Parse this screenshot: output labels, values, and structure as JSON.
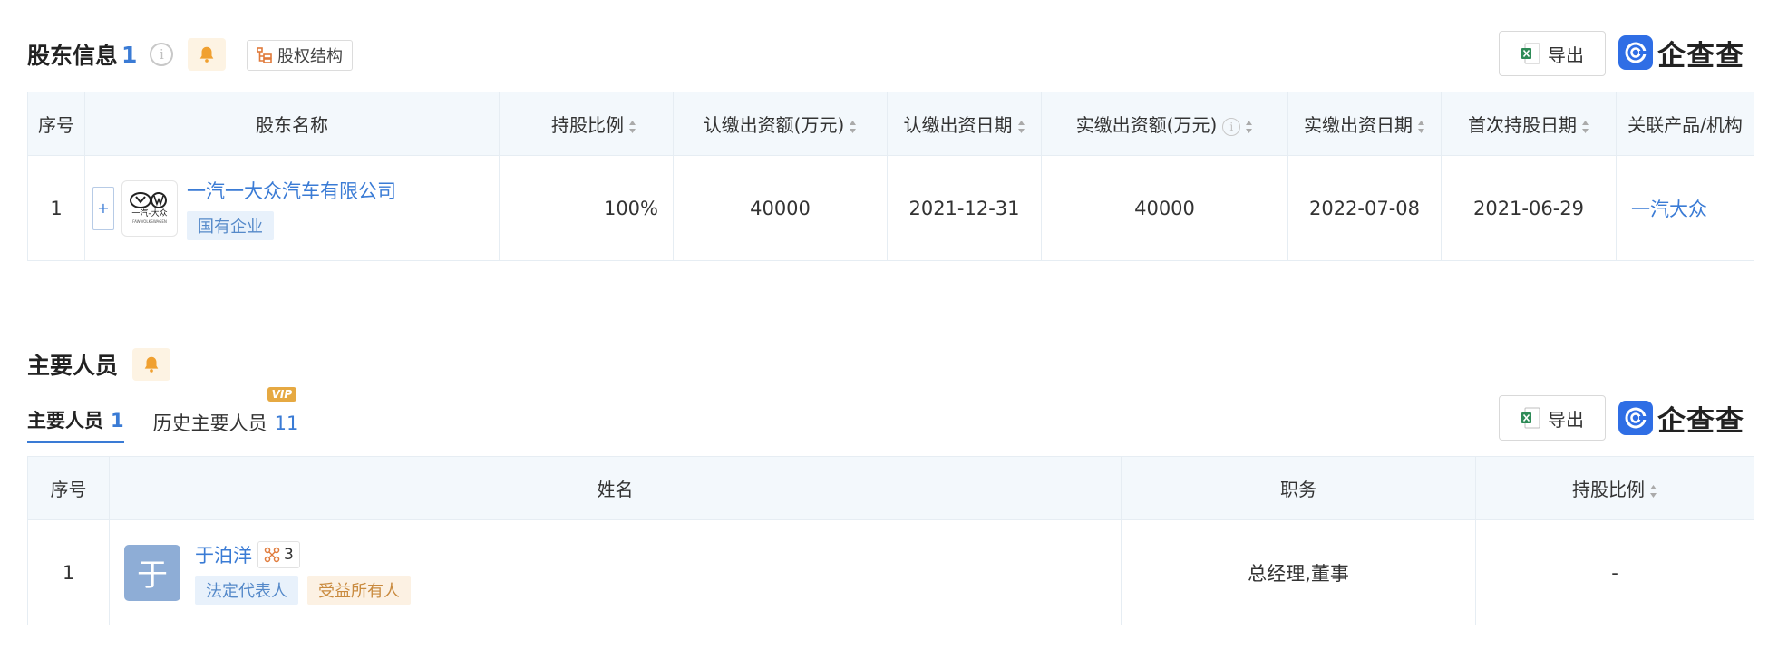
{
  "shareholders": {
    "title": "股东信息",
    "count": "1",
    "structure_btn": "股权结构",
    "export_label": "导出",
    "brand": "企查查",
    "columns": [
      "序号",
      "股东名称",
      "持股比例",
      "认缴出资额(万元)",
      "认缴出资日期",
      "实缴出资额(万元)",
      "实缴出资日期",
      "首次持股日期",
      "关联产品/机构"
    ],
    "rows": [
      {
        "index": "1",
        "plus": "+",
        "logo_text": "一汽-大众",
        "logo_sub": "FAW-VOLKSWAGEN",
        "name": "一汽一大众汽车有限公司",
        "tag": "国有企业",
        "ratio": "100%",
        "subscribed_amount": "40000",
        "subscribed_date": "2021-12-31",
        "paid_amount": "40000",
        "paid_date": "2022-07-08",
        "first_hold_date": "2021-06-29",
        "related": "一汽大众"
      }
    ]
  },
  "personnel": {
    "title": "主要人员",
    "tabs": [
      {
        "label": "主要人员",
        "count": "1"
      },
      {
        "label": "历史主要人员",
        "count": "11",
        "badge": "VIP"
      }
    ],
    "export_label": "导出",
    "brand": "企查查",
    "columns": [
      "序号",
      "姓名",
      "职务",
      "持股比例"
    ],
    "rows": [
      {
        "index": "1",
        "avatar": "于",
        "name": "于泊洋",
        "relation_count": "3",
        "tag1": "法定代表人",
        "tag2": "受益所有人",
        "position": "总经理,董事",
        "ratio": "-"
      }
    ]
  },
  "colors": {
    "accent": "#3a7bd5",
    "header_bg": "#f3f8fc",
    "bell": "#f0a030",
    "brand": "#2f6ee5"
  }
}
